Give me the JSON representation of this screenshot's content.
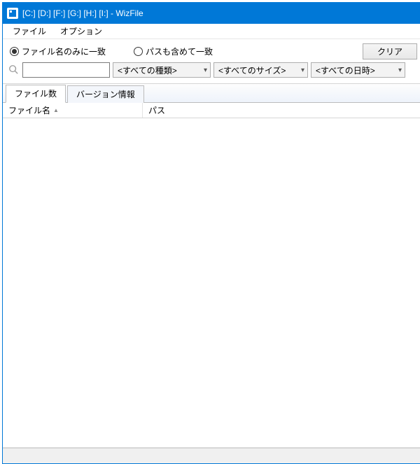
{
  "titlebar": {
    "title": "[C:] [D:] [F:] [G:] [H:] [I:]  - WizFile"
  },
  "menubar": {
    "file": "ファイル",
    "options": "オプション"
  },
  "filters": {
    "radio_filename_only": "ファイル名のみに一致",
    "radio_include_path": "パスも含めて一致",
    "clear_button": "クリア"
  },
  "search": {
    "value": "",
    "type_combo": "<すべての種類>",
    "size_combo": "<すべてのサイズ>",
    "date_combo": "<すべての日時>"
  },
  "tabs": {
    "file_count": "ファイル数",
    "version_info": "バージョン情報"
  },
  "columns": {
    "name": "ファイル名",
    "path": "パス"
  }
}
